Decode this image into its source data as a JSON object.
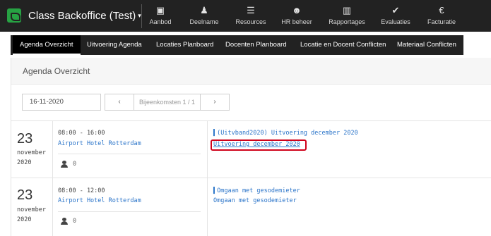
{
  "app": {
    "title": "Class Backoffice (Test)",
    "caret": "▾"
  },
  "nav": [
    {
      "label": "Aanbod",
      "icon": "▣"
    },
    {
      "label": "Deelname",
      "icon": "♟"
    },
    {
      "label": "Resources",
      "icon": "☰"
    },
    {
      "label": "HR beheer",
      "icon": "☻"
    },
    {
      "label": "Rapportages",
      "icon": "▥"
    },
    {
      "label": "Evaluaties",
      "icon": "✔"
    },
    {
      "label": "Facturatie",
      "icon": "€"
    }
  ],
  "icons": {
    "brand": "class-logo-icon",
    "nav": [
      "box-icon",
      "person-icon",
      "server-icon",
      "group-icon",
      "chart-icon",
      "check-icon",
      "euro-icon"
    ],
    "participants": "user-icon"
  },
  "subnav": [
    {
      "label": "Agenda Overzicht",
      "active": true
    },
    {
      "label": "Uitvoering Agenda"
    },
    {
      "label": "Locaties Planboard"
    },
    {
      "label": "Docenten Planboard"
    },
    {
      "label": "Locatie en Docent Conflicten"
    },
    {
      "label": "Materiaal Conflicten"
    }
  ],
  "page": {
    "title": "Agenda Overzicht"
  },
  "filter": {
    "date": "16-11-2020",
    "prev": "‹",
    "next": "›",
    "pager_text": "Bijeenkomsten 1 / 1"
  },
  "sessions": [
    {
      "day": "23",
      "month": "november",
      "year": "2020",
      "time": "08:00 - 16:00",
      "location": "Airport Hotel Rotterdam",
      "participants": "0",
      "tag": "▍(Uitvband2020) Uitvoering december 2020",
      "link": "Uitvoering december 2020"
    },
    {
      "day": "23",
      "month": "november",
      "year": "2020",
      "time": "08:00 - 12:00",
      "location": "Airport Hotel Rotterdam",
      "participants": "0",
      "tag": "▍Omgaan met gesodemieter",
      "link": "Omgaan met gesodemieter"
    }
  ],
  "colors": {
    "topbar": "#222222",
    "brand": "#27a243",
    "link": "#2a74c9",
    "highlight": "#d0021b"
  }
}
